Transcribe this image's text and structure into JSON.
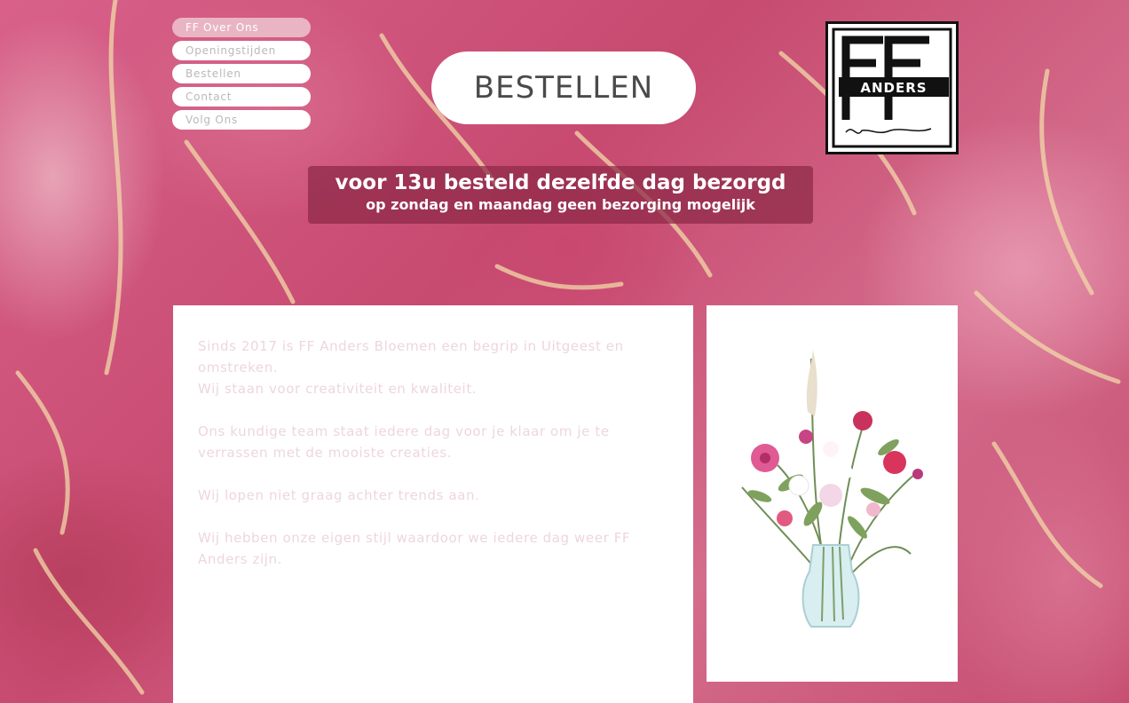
{
  "nav": {
    "items": [
      {
        "label": "FF Over Ons"
      },
      {
        "label": "Openingstijden"
      },
      {
        "label": "Bestellen"
      },
      {
        "label": "Contact"
      },
      {
        "label": "Volg Ons"
      }
    ]
  },
  "hero": {
    "button_label": "BESTELLEN"
  },
  "logo": {
    "main": "FF",
    "sub": "ANDERS",
    "script": "Bloemen"
  },
  "banner": {
    "line1": "voor 13u besteld dezelfde dag bezorgd",
    "line2": "op zondag en maandag geen bezorging mogelijk"
  },
  "content": {
    "paragraphs": [
      "Sinds 2017 is FF Anders Bloemen een begrip in Uitgeest en omstreken.",
      "Wij staan voor creativiteit en kwaliteit.",
      "Ons kundige team staat iedere dag voor je klaar om je te verrassen met de mooiste creaties.",
      "Wij lopen niet graag achter trends aan.",
      "Wij hebben onze eigen stijl waardoor we iedere dag weer FF Anders zijn."
    ]
  },
  "colors": {
    "accent": "#e9b5c4",
    "banner": "#8c2846",
    "text_faded": "#eed6dd"
  }
}
